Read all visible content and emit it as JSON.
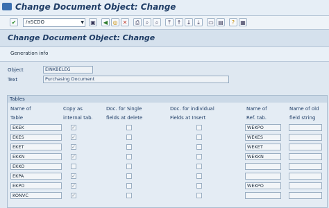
{
  "window": {
    "title": "Change Document Object: Change"
  },
  "toolbar": {
    "command_value": "/nSCDO"
  },
  "screen": {
    "title": "Change Document Object: Change"
  },
  "app_toolbar": {
    "generation_info": "Generation info"
  },
  "header": {
    "object_label": "Object",
    "object_value": "EINKBELEG",
    "text_label": "Text",
    "text_value": "Purchasing Document"
  },
  "tables": {
    "group_title": "Tables",
    "columns": {
      "name_of_table": [
        "Name of",
        "Table"
      ],
      "copy_as": [
        "Copy as",
        "internal tab."
      ],
      "doc_single": [
        "Doc. for Single",
        "fields at delete"
      ],
      "doc_individual": [
        "Doc. for individual",
        "Fields at Insert"
      ],
      "name_ref": [
        "Name of",
        "Ref. tab."
      ],
      "name_old": [
        "Name of old",
        "field string"
      ]
    },
    "rows": [
      {
        "table": "EKEK",
        "copy": true,
        "single": false,
        "individual": false,
        "ref": "WEKPO",
        "old": ""
      },
      {
        "table": "EKES",
        "copy": true,
        "single": false,
        "individual": false,
        "ref": "WEKES",
        "old": ""
      },
      {
        "table": "EKET",
        "copy": true,
        "single": false,
        "individual": false,
        "ref": "WEKET",
        "old": ""
      },
      {
        "table": "EKKN",
        "copy": true,
        "single": false,
        "individual": false,
        "ref": "WEKKN",
        "old": ""
      },
      {
        "table": "EKKO",
        "copy": false,
        "single": false,
        "individual": false,
        "ref": "",
        "old": ""
      },
      {
        "table": "EKPA",
        "copy": true,
        "single": false,
        "individual": false,
        "ref": "",
        "old": ""
      },
      {
        "table": "EKPO",
        "copy": true,
        "single": false,
        "individual": false,
        "ref": "WEKPO",
        "old": ""
      },
      {
        "table": "KONVC",
        "copy": true,
        "single": false,
        "individual": false,
        "ref": "",
        "old": ""
      }
    ]
  }
}
